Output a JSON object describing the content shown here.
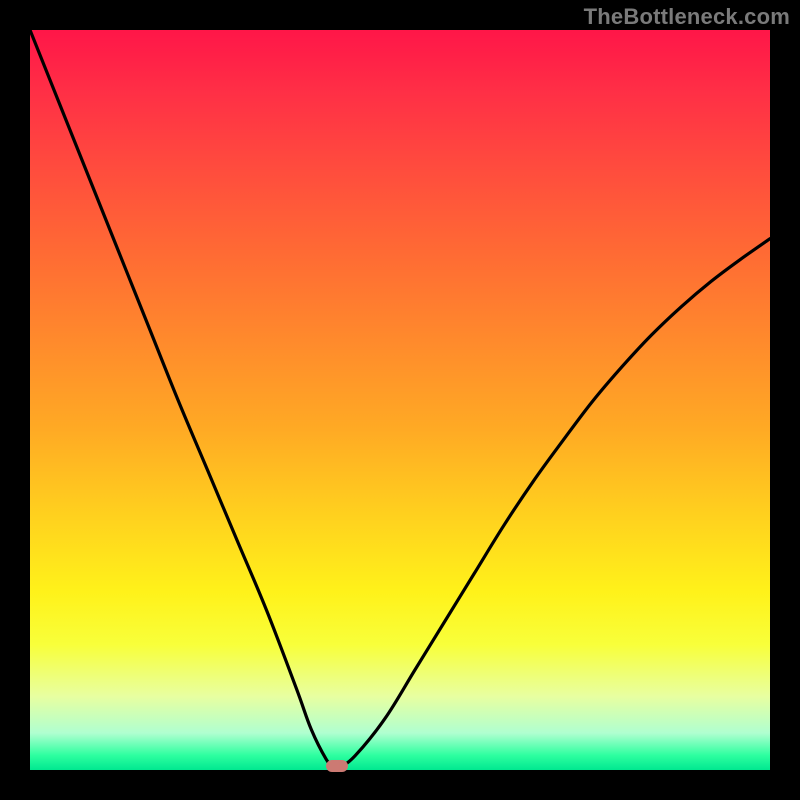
{
  "watermark": "TheBottleneck.com",
  "colors": {
    "background": "#000000",
    "curve_stroke": "#000000",
    "marker_fill": "#cc7a73"
  },
  "chart_data": {
    "type": "line",
    "title": "",
    "xlabel": "",
    "ylabel": "",
    "xlim": [
      0,
      100
    ],
    "ylim": [
      0,
      100
    ],
    "series": [
      {
        "name": "bottleneck-curve",
        "x": [
          0,
          4,
          8,
          12,
          16,
          20,
          24,
          28,
          32,
          36,
          38,
          40,
          41,
          42,
          44,
          48,
          52,
          56,
          60,
          64,
          68,
          72,
          76,
          80,
          84,
          88,
          92,
          96,
          100
        ],
        "y": [
          100,
          90,
          80,
          70,
          60,
          50,
          40.5,
          31,
          21.5,
          11,
          5.5,
          1.5,
          0.5,
          0.5,
          2,
          7,
          13.5,
          20,
          26.5,
          33,
          39,
          44.5,
          49.8,
          54.5,
          58.8,
          62.6,
          66,
          69,
          71.8
        ]
      }
    ],
    "marker": {
      "name": "optimal-point",
      "x": 41.5,
      "y": 0.6
    },
    "grid": false,
    "legend": false
  }
}
